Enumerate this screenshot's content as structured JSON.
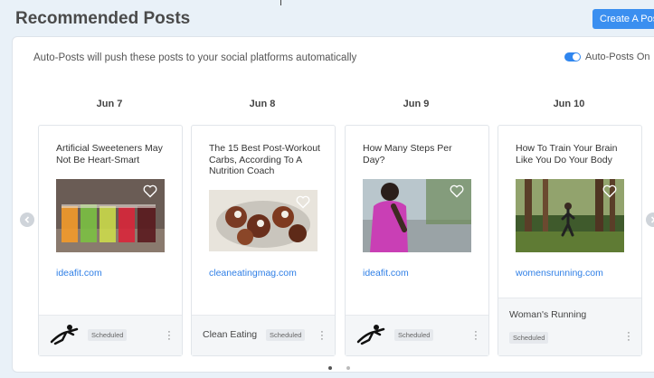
{
  "page": {
    "title": "Recommended Posts",
    "create_label": "Create A Post"
  },
  "panel": {
    "description": "Auto-Posts will push these posts to your social platforms automatically",
    "toggle_label": "Auto-Posts On",
    "toggle_on": true
  },
  "days": [
    "Jun 7",
    "Jun 8",
    "Jun 9",
    "Jun 10"
  ],
  "cards": [
    {
      "title": "Artificial Sweeteners May Not Be Heart-Smart",
      "link": "ideafit.com",
      "brand": "",
      "status": "Scheduled"
    },
    {
      "title": "The 15 Best Post-Workout Carbs, According To A Nutrition Coach",
      "link": "cleaneatingmag.com",
      "brand": "Clean Eating",
      "status": "Scheduled"
    },
    {
      "title": "How Many Steps Per Day?",
      "link": "ideafit.com",
      "brand": "",
      "status": "Scheduled"
    },
    {
      "title": "How To Train Your Brain Like You Do Your Body",
      "link": "womensrunning.com",
      "brand": "Woman's Running",
      "status": "Scheduled"
    }
  ],
  "colors": {
    "accent": "#3b8ff0",
    "link": "#2f7fe6"
  },
  "icons": [
    "heart-icon",
    "more-vertical-icon",
    "chevron-left-icon",
    "chevron-right-icon",
    "runner-logo-icon"
  ],
  "pagination": {
    "pages": 2,
    "current": 1
  }
}
